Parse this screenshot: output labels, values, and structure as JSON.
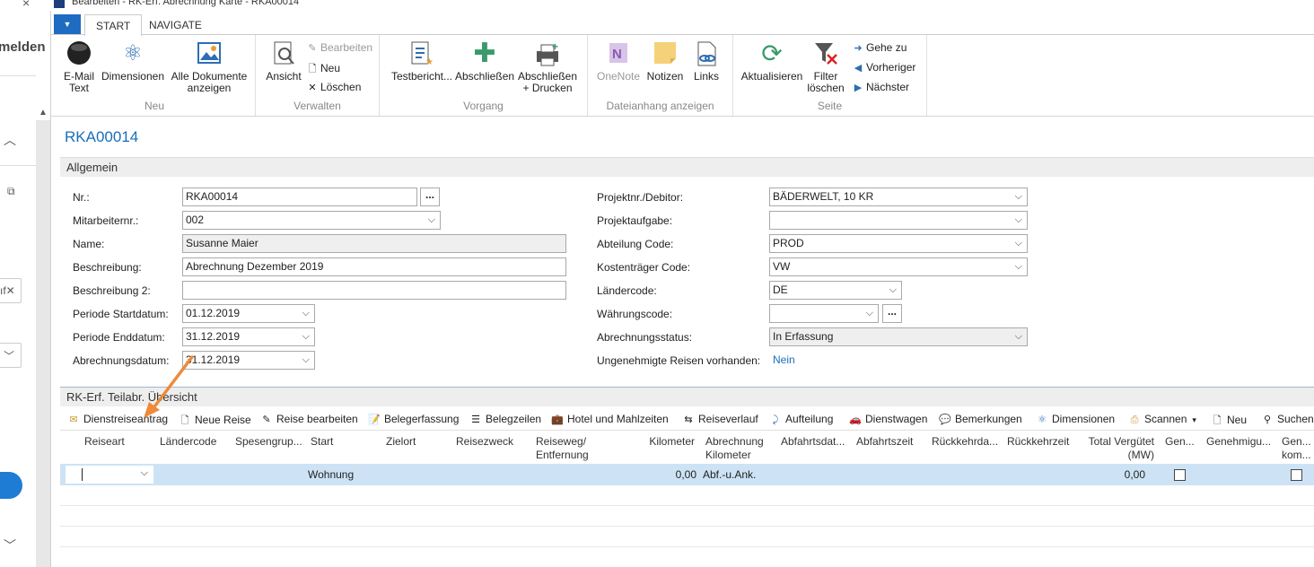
{
  "window": {
    "title": "Bearbeiten - RK-Erf. Abrechnung Karte - RKA00014",
    "close_glyph": "×"
  },
  "left": {
    "partial_label": "melden",
    "partial_field_text": "ıf✕"
  },
  "ribbon": {
    "tabs": [
      "START",
      "NAVIGATE"
    ],
    "groups": {
      "neu": {
        "label": "Neu",
        "email": "E-Mail\nText",
        "dimensionen": "Dimensionen",
        "alle_dok": "Alle Dokumente\nanzeigen"
      },
      "verwalten": {
        "label": "Verwalten",
        "ansicht": "Ansicht",
        "bearbeiten": "Bearbeiten",
        "neu": "Neu",
        "loeschen": "Löschen"
      },
      "vorgang": {
        "label": "Vorgang",
        "testbericht": "Testbericht...",
        "abschliessen": "Abschließen",
        "abschliessen_drucken": "Abschließen\n+ Drucken"
      },
      "dateianhang": {
        "label": "Dateianhang anzeigen",
        "onenote": "OneNote",
        "notizen": "Notizen",
        "links": "Links"
      },
      "seite": {
        "label": "Seite",
        "aktualisieren": "Aktualisieren",
        "filter": "Filter\nlöschen",
        "gehe_zu": "Gehe zu",
        "vorheriger": "Vorheriger",
        "naechster": "Nächster"
      }
    }
  },
  "card": {
    "title": "RKA00014",
    "section": "Allgemein",
    "fields_left": [
      {
        "label": "Nr.:",
        "value": "RKA00014"
      },
      {
        "label": "Mitarbeiternr.:",
        "value": "002"
      },
      {
        "label": "Name:",
        "value": "Susanne Maier"
      },
      {
        "label": "Beschreibung:",
        "value": "Abrechnung Dezember 2019"
      },
      {
        "label": "Beschreibung 2:",
        "value": ""
      },
      {
        "label": "Periode Startdatum:",
        "value": "01.12.2019"
      },
      {
        "label": "Periode Enddatum:",
        "value": "31.12.2019"
      },
      {
        "label": "Abrechnungsdatum:",
        "value": "31.12.2019"
      }
    ],
    "fields_right": [
      {
        "label": "Projektnr./Debitor:",
        "value": "BÄDERWELT, 10 KR"
      },
      {
        "label": "Projektaufgabe:",
        "value": ""
      },
      {
        "label": "Abteilung Code:",
        "value": "PROD"
      },
      {
        "label": "Kostenträger Code:",
        "value": "VW"
      },
      {
        "label": "Ländercode:",
        "value": "DE"
      },
      {
        "label": "Währungscode:",
        "value": ""
      },
      {
        "label": "Abrechnungsstatus:",
        "value": "In Erfassung"
      },
      {
        "label": "Ungenehmigte Reisen vorhanden:",
        "value": "Nein"
      }
    ],
    "ellipsis": "..."
  },
  "subpage": {
    "title": "RK-Erf. Teilabr. Übersicht",
    "actions": [
      "Dienstreiseantrag",
      "Neue Reise",
      "Reise bearbeiten",
      "Belegerfassung",
      "Belegzeilen",
      "Hotel und Mahlzeiten",
      "Reiseverlauf",
      "Aufteilung",
      "Dienstwagen",
      "Bemerkungen",
      "Dimensionen",
      "Scannen",
      "Neu",
      "Suchen"
    ],
    "columns": [
      "Reiseart",
      "Ländercode",
      "Spesengrup...",
      "Start",
      "Zielort",
      "Reisezweck",
      "Reiseweg/\nEntfernung",
      "Kilometer",
      "Abrechnung\nKilometer",
      "Abfahrtsdat...",
      "Abfahrtszeit",
      "Rückkehrda...",
      "Rückkehrzeit",
      "Total Vergütet\n(MW)",
      "Gen...",
      "Genehmigu...",
      "Gen...\nkom..."
    ],
    "row": {
      "start": "Wohnung",
      "kilometer": "0,00",
      "abrechnung": "Abf.-u.Ank.",
      "total": "0,00"
    }
  },
  "colors": {
    "accent": "#1a6fb8",
    "selected_row": "#cde3f5",
    "annotation_arrow": "#ee8a3a"
  }
}
